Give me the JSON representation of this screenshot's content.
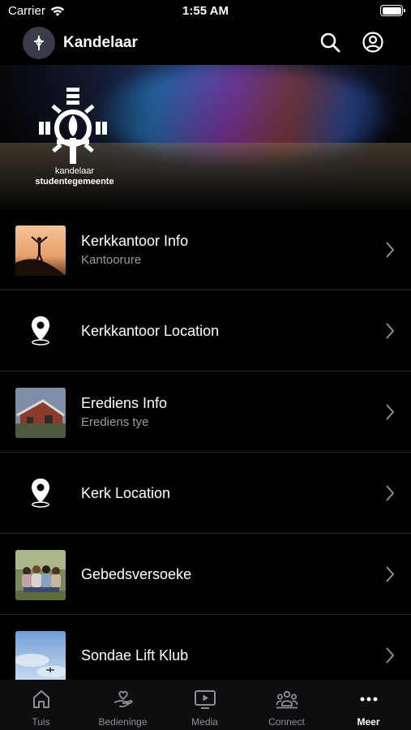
{
  "status_bar": {
    "carrier": "Carrier",
    "time": "1:55 AM"
  },
  "header": {
    "title": "Kandelaar",
    "icons": [
      "search-icon",
      "account-icon"
    ]
  },
  "banner": {
    "name_line1": "kandelaar",
    "name_line2": "studentegemeente"
  },
  "list": [
    {
      "title": "Kerkkantoor Info",
      "subtitle": "Kantoorure",
      "icon": "person-sunset-thumbnail"
    },
    {
      "title": "Kerkkantoor Location",
      "subtitle": "",
      "icon": "location-pin-icon"
    },
    {
      "title": "Erediens Info",
      "subtitle": "Erediens tye",
      "icon": "church-building-thumbnail"
    },
    {
      "title": "Kerk Location",
      "subtitle": "",
      "icon": "location-pin-icon"
    },
    {
      "title": "Gebedsversoeke",
      "subtitle": "",
      "icon": "group-hug-thumbnail"
    },
    {
      "title": "Sondae Lift Klub",
      "subtitle": "",
      "icon": "sky-plane-thumbnail"
    }
  ],
  "tabs": [
    {
      "label": "Tuis",
      "icon": "home-icon",
      "active": false
    },
    {
      "label": "Bedieninge",
      "icon": "heart-hand-icon",
      "active": false
    },
    {
      "label": "Media",
      "icon": "play-screen-icon",
      "active": false
    },
    {
      "label": "Connect",
      "icon": "people-icon",
      "active": false
    },
    {
      "label": "Meer",
      "icon": "more-icon",
      "active": true
    }
  ],
  "colors": {
    "background": "#000000",
    "secondary_text": "#9b9ba0",
    "inactive_tab": "#8e8e93",
    "separator": "#2a2a2c"
  }
}
